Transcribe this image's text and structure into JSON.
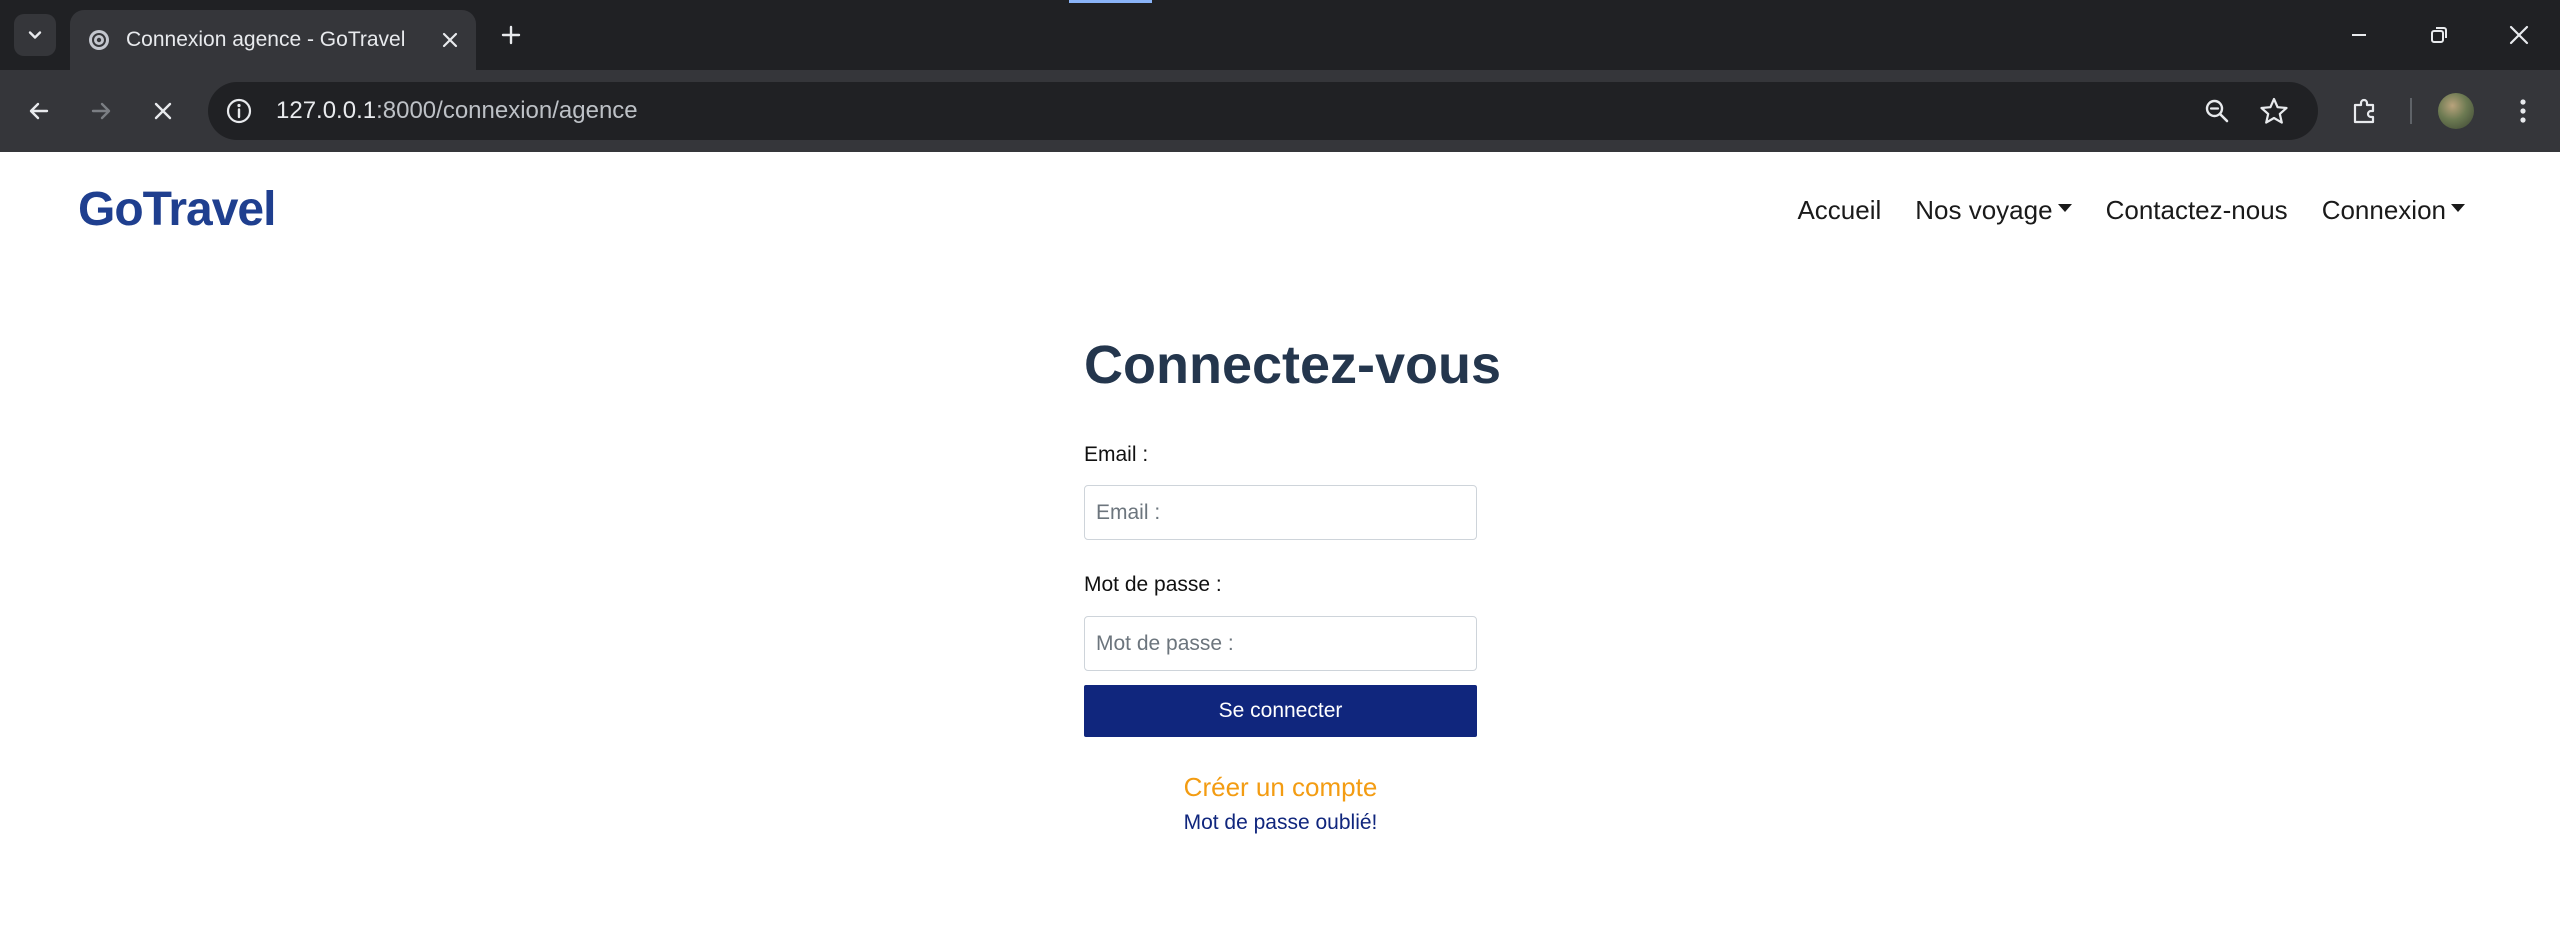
{
  "browser": {
    "tab_title": "Connexion agence - GoTravel",
    "url_host": "127.0.0.1",
    "url_path": ":8000/connexion/agence"
  },
  "icons": {
    "tab_search": "chevron-down-icon",
    "favicon": "globe-icon",
    "tab_close": "close-icon",
    "new_tab": "plus-icon",
    "minimize": "minimize-icon",
    "restore": "restore-icon",
    "close_window": "close-icon",
    "back": "arrow-left-icon",
    "forward": "arrow-right-icon",
    "stop": "stop-loading-icon",
    "site_info": "info-icon",
    "zoom": "zoom-out-icon",
    "bookmark": "star-icon",
    "extensions": "puzzle-icon",
    "profile": "avatar",
    "menu": "kebab-menu-icon"
  },
  "colors": {
    "brand": "#1f3f8f",
    "button": "#10267d",
    "create_link": "#f39c12",
    "title": "#24364d"
  },
  "site": {
    "logo": "GoTravel",
    "nav": {
      "home": "Accueil",
      "trips": "Nos voyage",
      "contact": "Contactez-nous",
      "login": "Connexion"
    }
  },
  "login": {
    "title": "Connectez-vous",
    "email_label": "Email :",
    "email_placeholder": "Email :",
    "email_value": "",
    "password_label": "Mot de passe :",
    "password_placeholder": "Mot de passe :",
    "password_value": "",
    "submit_label": "Se connecter",
    "create_account": "Créer un compte",
    "forgot_password": "Mot de passe oublié!"
  }
}
